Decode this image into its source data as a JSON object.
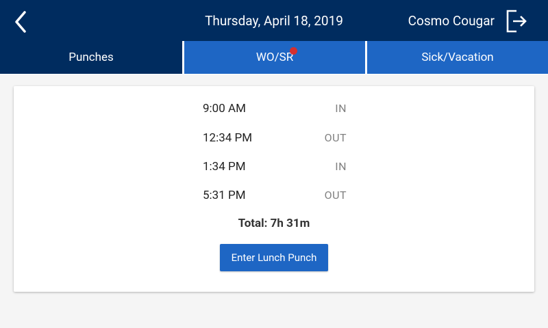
{
  "header": {
    "date": "Thursday, April 18, 2019",
    "user_name": "Cosmo Cougar",
    "back_icon": "chevron-left-icon",
    "logout_icon": "logout-icon"
  },
  "tabs": [
    {
      "label": "Punches",
      "active": true
    },
    {
      "label": "WO/SR",
      "active": false,
      "has_notification": true
    },
    {
      "label": "Sick/Vacation",
      "active": false
    }
  ],
  "punches": [
    {
      "time": "9:00 AM",
      "type": "IN"
    },
    {
      "time": "12:34 PM",
      "type": "OUT"
    },
    {
      "time": "1:34 PM",
      "type": "IN"
    },
    {
      "time": "5:31 PM",
      "type": "OUT"
    }
  ],
  "total": "Total: 7h 31m",
  "lunch_button_label": "Enter Lunch Punch",
  "colors": {
    "header_bg": "#002c5f",
    "tab_active_bg": "#002c5f",
    "tab_bg": "#1e66c4",
    "button_bg": "#1e66c4",
    "notification_dot": "#d32f2f",
    "page_bg": "#f5f5f5"
  }
}
